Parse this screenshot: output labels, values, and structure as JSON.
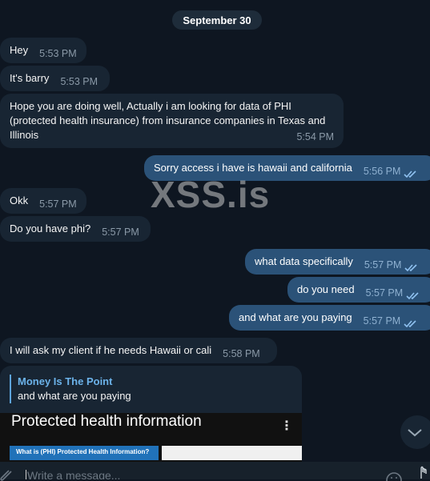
{
  "date_separator": "September 30",
  "messages": [
    {
      "text": "Hey",
      "time": "5:53 PM"
    },
    {
      "text": "It's barry",
      "time": "5:53 PM"
    },
    {
      "text": "Hope you are doing well, Actually i am looking for data of PHI (protected health insurance) from insurance companies in Texas and Illinois",
      "time": "5:54 PM"
    },
    {
      "text": "Sorry access i have is hawaii and california",
      "time": "5:56 PM"
    },
    {
      "text": "Okk",
      "time": "5:57 PM"
    },
    {
      "text": "Do you have phi?",
      "time": "5:57 PM"
    },
    {
      "text": "what data specifically",
      "time": "5:57 PM"
    },
    {
      "text": "do you need",
      "time": "5:57 PM"
    },
    {
      "text": "and what are you paying",
      "time": "5:57 PM"
    },
    {
      "text": "I will ask my client if he needs Hawaii or cali",
      "time": "5:58 PM"
    }
  ],
  "watermark": "XSS.is",
  "reply": {
    "quoted_name": "Money Is The Point",
    "quoted_text": "and what are you paying",
    "preview_title": "Protected health information",
    "preview_banner": "What is (PHI) Protected Health Information?",
    "preview_menu": "⋮"
  },
  "composer": {
    "placeholder": "Write a message..."
  },
  "icons": {
    "attach": "paperclip-icon",
    "emoji": "emoji-icon",
    "mic": "microphone-icon",
    "scroll": "chevron-down-icon",
    "read": "double-check-icon"
  },
  "colors": {
    "background": "#0e1621",
    "incoming_bubble": "#182533",
    "outgoing_bubble": "#2b5278",
    "link_accent": "#6cb3ea"
  }
}
